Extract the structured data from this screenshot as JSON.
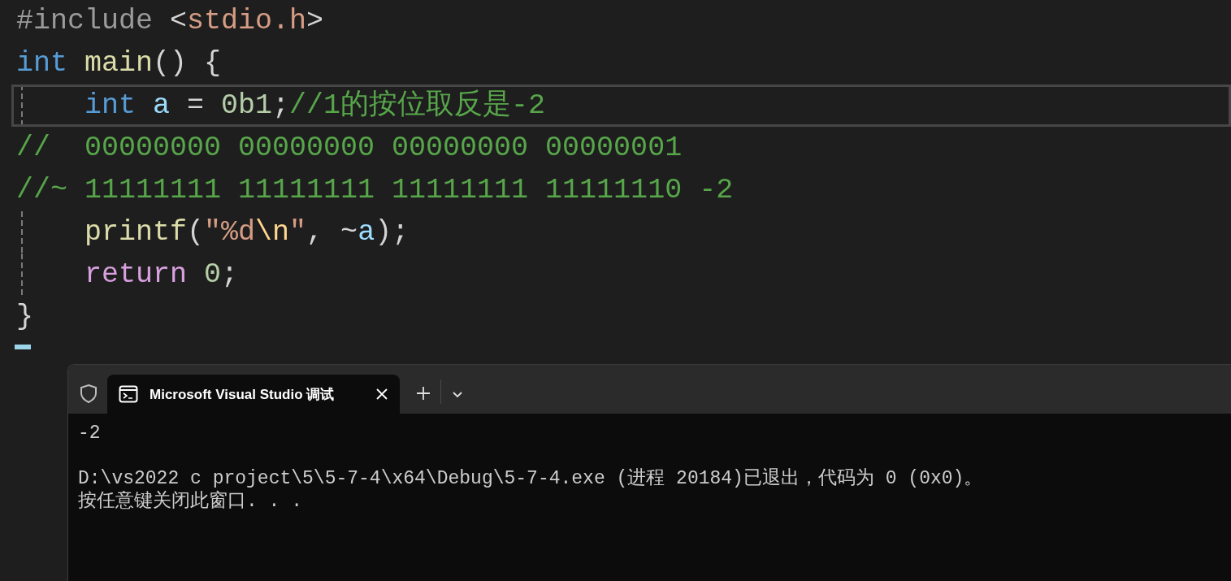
{
  "editor": {
    "lines": [
      {
        "current": false,
        "guide": false,
        "tokens": [
          {
            "kind": "directive",
            "text": "#include"
          },
          {
            "kind": "plain",
            "text": " <"
          },
          {
            "kind": "header",
            "text": "stdio.h"
          },
          {
            "kind": "plain",
            "text": ">"
          }
        ]
      },
      {
        "current": false,
        "guide": false,
        "tokens": [
          {
            "kind": "keyword",
            "text": "int"
          },
          {
            "kind": "function",
            "text": " main"
          },
          {
            "kind": "plain",
            "text": "() {"
          }
        ]
      },
      {
        "current": true,
        "guide": true,
        "tokens": [
          {
            "kind": "keyword",
            "text": "    int"
          },
          {
            "kind": "variable",
            "text": " a"
          },
          {
            "kind": "plain",
            "text": " = "
          },
          {
            "kind": "number",
            "text": "0b1"
          },
          {
            "kind": "plain",
            "text": ";"
          },
          {
            "kind": "comment",
            "text": "//1的按位取反是-2"
          }
        ]
      },
      {
        "current": false,
        "guide": false,
        "tokens": [
          {
            "kind": "comment",
            "text": "//  00000000 00000000 00000000 00000001"
          }
        ]
      },
      {
        "current": false,
        "guide": false,
        "tokens": [
          {
            "kind": "comment",
            "text": "//~ 11111111 11111111 11111111 11111110 -2"
          }
        ]
      },
      {
        "current": false,
        "guide": true,
        "tokens": [
          {
            "kind": "function",
            "text": "    printf"
          },
          {
            "kind": "plain",
            "text": "("
          },
          {
            "kind": "string",
            "text": "\"%d"
          },
          {
            "kind": "escape",
            "text": "\\n"
          },
          {
            "kind": "string",
            "text": "\""
          },
          {
            "kind": "plain",
            "text": ", ~"
          },
          {
            "kind": "variable",
            "text": "a"
          },
          {
            "kind": "plain",
            "text": ");"
          }
        ]
      },
      {
        "current": false,
        "guide": true,
        "tokens": [
          {
            "kind": "control",
            "text": "    return"
          },
          {
            "kind": "number",
            "text": " 0"
          },
          {
            "kind": "plain",
            "text": ";"
          }
        ]
      },
      {
        "current": false,
        "guide": false,
        "tokens": [
          {
            "kind": "plain",
            "text": "}"
          }
        ]
      }
    ]
  },
  "terminal": {
    "tabs": [
      {
        "title": "Microsoft Visual Studio 调试",
        "selected": true
      }
    ],
    "output": [
      [
        "-2"
      ],
      [
        "D:\\vs2022 c project\\5\\5-7-4\\x64\\Debug\\5-7-4.exe (进程 20184)已退出，代码为 0 (0x0)。",
        "按任意键关闭此窗口. . ."
      ]
    ]
  }
}
